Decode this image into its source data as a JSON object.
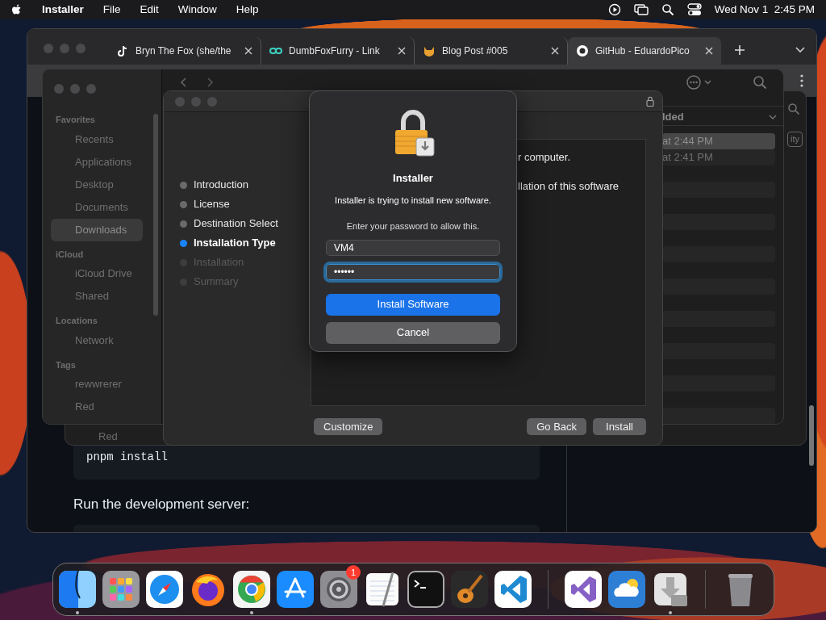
{
  "menu_bar": {
    "app": "Installer",
    "menus": [
      "File",
      "Edit",
      "Window",
      "Help"
    ],
    "clock": "Wed Nov 1  2:45 PM"
  },
  "browser": {
    "tabs": [
      {
        "title": "Bryn The Fox (she/the",
        "selected": false
      },
      {
        "title": "DumbFoxFurry - Link",
        "selected": false
      },
      {
        "title": "Blog Post #005",
        "selected": false
      },
      {
        "title": "GitHub - EduardoPico",
        "selected": true
      }
    ],
    "code_block": "pnpm install",
    "paragraph": "Run the development server:"
  },
  "back_window": {
    "tag": "Red",
    "button": "ity"
  },
  "finder": {
    "sidebar": [
      {
        "heading": "Favorites",
        "items": [
          {
            "label": "Recents",
            "selected": false
          },
          {
            "label": "Applications",
            "selected": false
          },
          {
            "label": "Desktop",
            "selected": false
          },
          {
            "label": "Documents",
            "selected": false
          },
          {
            "label": "Downloads",
            "selected": true
          }
        ]
      },
      {
        "heading": "iCloud",
        "items": [
          {
            "label": "iCloud Drive",
            "selected": false
          },
          {
            "label": "Shared",
            "selected": false
          }
        ]
      },
      {
        "heading": "Locations",
        "items": [
          {
            "label": "Network",
            "selected": false
          }
        ]
      },
      {
        "heading": "Tags",
        "items": [
          {
            "label": "rewwrerer",
            "selected": false
          },
          {
            "label": "Red",
            "selected": false
          }
        ]
      }
    ],
    "list": {
      "column_header": "lded",
      "rows": [
        {
          "text": "at 2:44 PM",
          "selected": true
        },
        {
          "text": "at 2:41 PM",
          "selected": false
        }
      ]
    }
  },
  "installer": {
    "steps": [
      {
        "label": "Introduction",
        "selected": false,
        "disabled": false
      },
      {
        "label": "License",
        "selected": false,
        "disabled": false
      },
      {
        "label": "Destination Select",
        "selected": false,
        "disabled": false
      },
      {
        "label": "Installation Type",
        "selected": true,
        "disabled": false
      },
      {
        "label": "Installation",
        "selected": false,
        "disabled": true
      },
      {
        "label": "Summary",
        "selected": false,
        "disabled": true
      }
    ],
    "body": [
      "r computer.",
      "llation of this software"
    ],
    "customize": "Customize",
    "go_back": "Go Back",
    "install": "Install"
  },
  "auth_dialog": {
    "title": "Installer",
    "message": "Installer is trying to install new software.",
    "prompt": "Enter your password to allow this.",
    "username": "VM4",
    "password": "••••••",
    "password_focused": true,
    "buttons": [
      {
        "label": "Install Software",
        "kind": "primary"
      },
      {
        "label": "Cancel",
        "kind": "secondary"
      }
    ]
  },
  "dock": {
    "items": [
      {
        "running": true
      },
      {
        "running": false
      },
      {
        "running": false
      },
      {
        "running": false
      },
      {
        "running": true
      },
      {
        "running": false
      },
      {
        "running": false,
        "badge": "1"
      },
      {
        "running": false
      },
      {
        "running": false
      },
      {
        "running": false
      },
      {
        "running": false
      },
      {
        "running": false
      },
      {
        "running": false
      },
      {
        "running": true
      },
      {
        "running": false
      }
    ]
  }
}
